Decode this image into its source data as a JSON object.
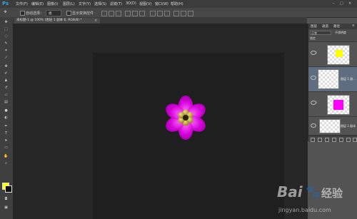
{
  "app": {
    "logo": "Ps",
    "menu": [
      "文件(F)",
      "编辑(E)",
      "图像(I)",
      "图层(L)",
      "文字(Y)",
      "选择(S)",
      "滤镜(T)",
      "3D(D)",
      "视图(V)",
      "窗口(W)",
      "帮助(H)"
    ],
    "window_controls": [
      "–",
      "□",
      "✕"
    ]
  },
  "options_bar": {
    "auto_select_label": "自动选择：",
    "auto_select_value": "组",
    "show_transform_label": "显示变换控件"
  },
  "document": {
    "tab_title": "未标题-1 @ 100% (图层 1 副本 6, RGB/8) *",
    "close": "×"
  },
  "toolbox": {
    "tools": [
      "move-tool",
      "marquee-tool",
      "lasso-tool",
      "quick-select-tool",
      "crop-tool",
      "eyedropper-tool",
      "healing-brush-tool",
      "brush-tool",
      "clone-stamp-tool",
      "history-brush-tool",
      "eraser-tool",
      "gradient-tool",
      "blur-tool",
      "dodge-tool",
      "pen-tool",
      "type-tool",
      "path-select-tool",
      "shape-tool",
      "hand-tool",
      "zoom-tool"
    ],
    "foreground_color": "#ffff00",
    "background_color": "#111111"
  },
  "layers_panel": {
    "tabs": [
      "图层",
      "通道",
      "路径"
    ],
    "blend_mode": "正常",
    "opacity_label": "不透明度",
    "lock_label": "锁定",
    "layers": [
      {
        "name": "",
        "thumb_color": "#ffff00",
        "selected": false
      },
      {
        "name": "图层 1 副...",
        "thumb_color": "",
        "selected": true
      },
      {
        "name": "",
        "thumb_color": "#ff00ff",
        "selected": false
      },
      {
        "name": "图层 1 副本",
        "thumb_color": "",
        "selected": false
      }
    ]
  },
  "watermark": {
    "brand": "Bai",
    "brand_cn": "经验",
    "url": "jingyan.baidu.com"
  },
  "colors": {
    "petal": "#d400d8",
    "petal_highlight": "#ff5cff",
    "center": "#b8a23a",
    "selection_accent": "#5f6d80"
  }
}
